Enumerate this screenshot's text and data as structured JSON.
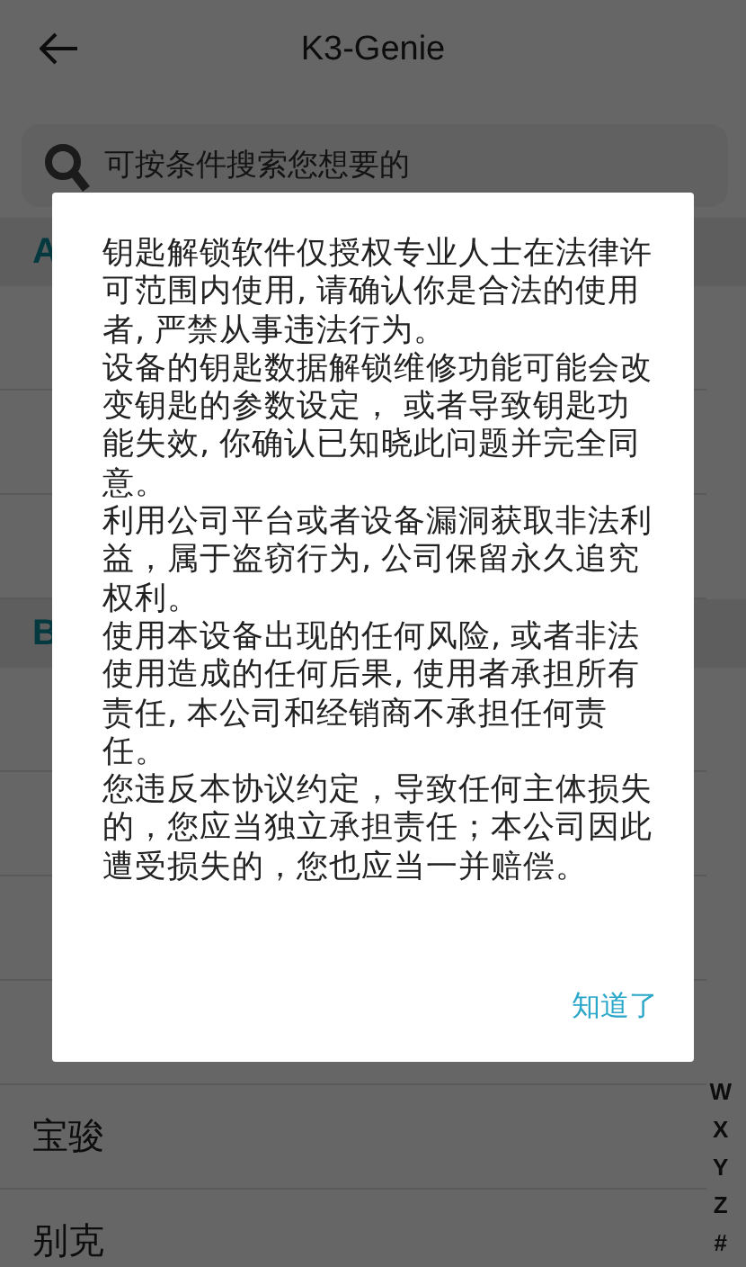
{
  "header": {
    "title": "K3-Genie"
  },
  "search": {
    "placeholder": "可按条件搜索您想要的"
  },
  "sections": [
    {
      "letter": "A"
    },
    {
      "letter": "B",
      "items": [
        "宝骏",
        "别克"
      ]
    }
  ],
  "index_letters": [
    "W",
    "X",
    "Y",
    "Z",
    "#"
  ],
  "dialog": {
    "paragraphs": [
      "钥匙解锁软件仅授权专业人士在法律许可范围内使用, 请确认你是合法的使用者, 严禁从事违法行为。",
      "设备的钥匙数据解锁维修功能可能会改变钥匙的参数设定， 或者导致钥匙功能失效, 你确认已知晓此问题并完全同意。",
      "利用公司平台或者设备漏洞获取非法利益，属于盗窃行为, 公司保留永久追究权利。",
      "使用本设备出现的任何风险, 或者非法使用造成的任何后果, 使用者承担所有责任, 本公司和经销商不承担任何责任。",
      "您违反本协议约定，导致任何主体损失的，您应当独立承担责任；本公司因此遭受损失的，您也应当一并赔偿。"
    ],
    "button": "知道了"
  }
}
